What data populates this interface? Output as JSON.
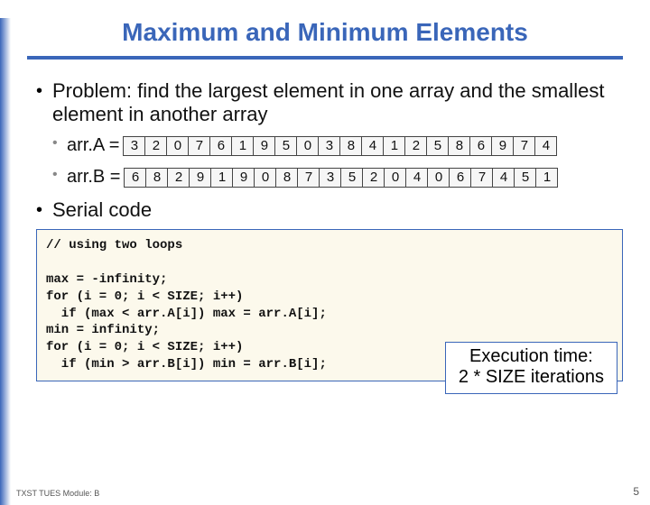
{
  "title": "Maximum and Minimum Elements",
  "bullets": {
    "problem": "Problem: find the largest element in one array and the smallest element in another array",
    "serial": "Serial code"
  },
  "arrays": {
    "a": {
      "label": "arr.A =",
      "values": [
        3,
        2,
        0,
        7,
        6,
        1,
        9,
        5,
        0,
        3,
        8,
        4,
        1,
        2,
        5,
        8,
        6,
        9,
        7,
        4
      ]
    },
    "b": {
      "label": "arr.B =",
      "values": [
        6,
        8,
        2,
        9,
        1,
        9,
        0,
        8,
        7,
        3,
        5,
        2,
        0,
        4,
        0,
        6,
        7,
        4,
        5,
        1
      ]
    }
  },
  "code_lines": [
    "// using two loops",
    "",
    "max = -infinity;",
    "for (i = 0; i < SIZE; i++)",
    "  if (max < arr.A[i]) max = arr.A[i];",
    "min = infinity;",
    "for (i = 0; i < SIZE; i++)",
    "  if (min > arr.B[i]) min = arr.B[i];"
  ],
  "callout": {
    "line1": "Execution time:",
    "line2": "2 * SIZE iterations"
  },
  "footer": {
    "left": "TXST TUES Module: B",
    "right": "5"
  }
}
